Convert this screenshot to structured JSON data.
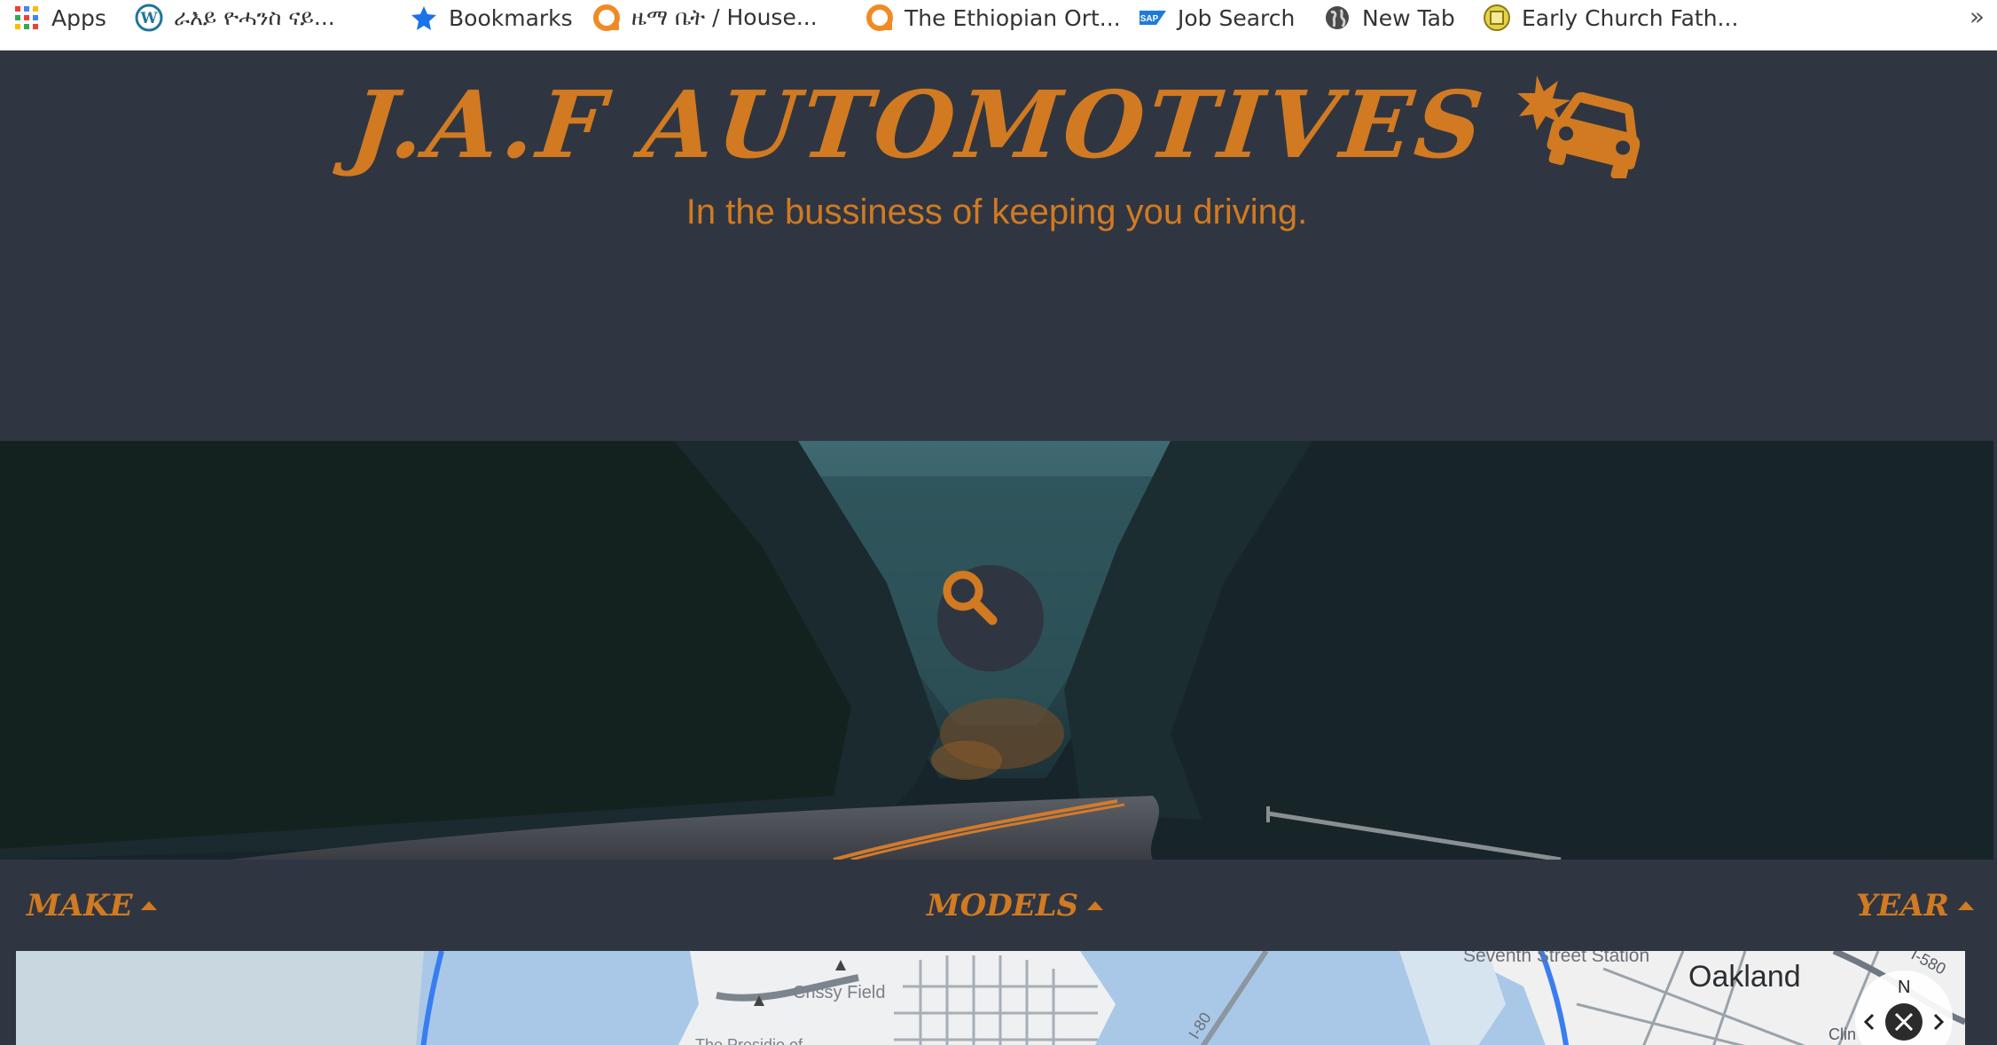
{
  "bookmarks": {
    "items": [
      {
        "label": "Apps",
        "icon": "apps-grid-icon"
      },
      {
        "label": "ራእይ ዮሓንስ ናይ...",
        "icon": "wordpress-icon"
      },
      {
        "label": "Bookmarks",
        "icon": "star-icon"
      },
      {
        "label": "ዜማ ቤት / House...",
        "icon": "orange-ring-icon"
      },
      {
        "label": "The Ethiopian Ort...",
        "icon": "orange-ring-icon"
      },
      {
        "label": "Job Search",
        "icon": "sap-icon"
      },
      {
        "label": "New Tab",
        "icon": "globe-icon"
      },
      {
        "label": "Early Church Fath...",
        "icon": "badge-icon"
      }
    ],
    "more": "»"
  },
  "header": {
    "brand": "J.A.F Automotives",
    "brand_icon": "car-crash-icon",
    "tagline": "In the bussiness of keeping you driving."
  },
  "hero": {
    "search_icon": "search-icon"
  },
  "filters": {
    "make": "Make",
    "models": "Models",
    "year": "Year"
  },
  "map": {
    "labels": {
      "crissy": "Crissy Field",
      "presidio": "The Presidio of",
      "seventh": "Seventh Street Station",
      "oakland": "Oakland",
      "i80": "I-80",
      "i580": "I-580",
      "clin": "Clin",
      "north": "N"
    }
  },
  "colors": {
    "accent": "#d17a22",
    "header_bg": "#303641",
    "map_water": "#a9c8e8"
  }
}
